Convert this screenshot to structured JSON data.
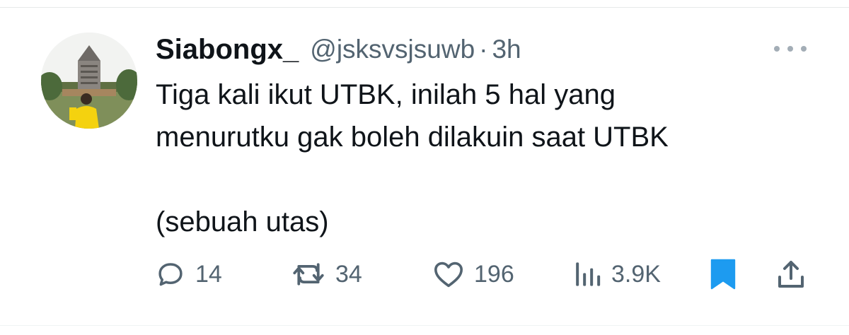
{
  "author": {
    "display_name": "Siabongx_",
    "handle": "@jsksvsjsuwb",
    "separator": "·",
    "time": "3h"
  },
  "tweet": {
    "line1": "Tiga kali ikut UTBK, inilah 5 hal yang",
    "line2": "menurutku gak boleh dilakuin saat UTBK",
    "line3": "(sebuah utas)"
  },
  "actions": {
    "replies": "14",
    "retweets": "34",
    "likes": "196",
    "views": "3.9K"
  },
  "icons": {
    "reply": "reply-icon",
    "retweet": "retweet-icon",
    "like": "heart-icon",
    "views": "analytics-icon",
    "bookmark": "bookmark-icon",
    "share": "share-icon",
    "more": "more-options-icon"
  },
  "colors": {
    "text": "#0f1419",
    "secondary": "#536471",
    "bookmark_active": "#1d9bf0",
    "more_dots": "#a3adb6"
  }
}
